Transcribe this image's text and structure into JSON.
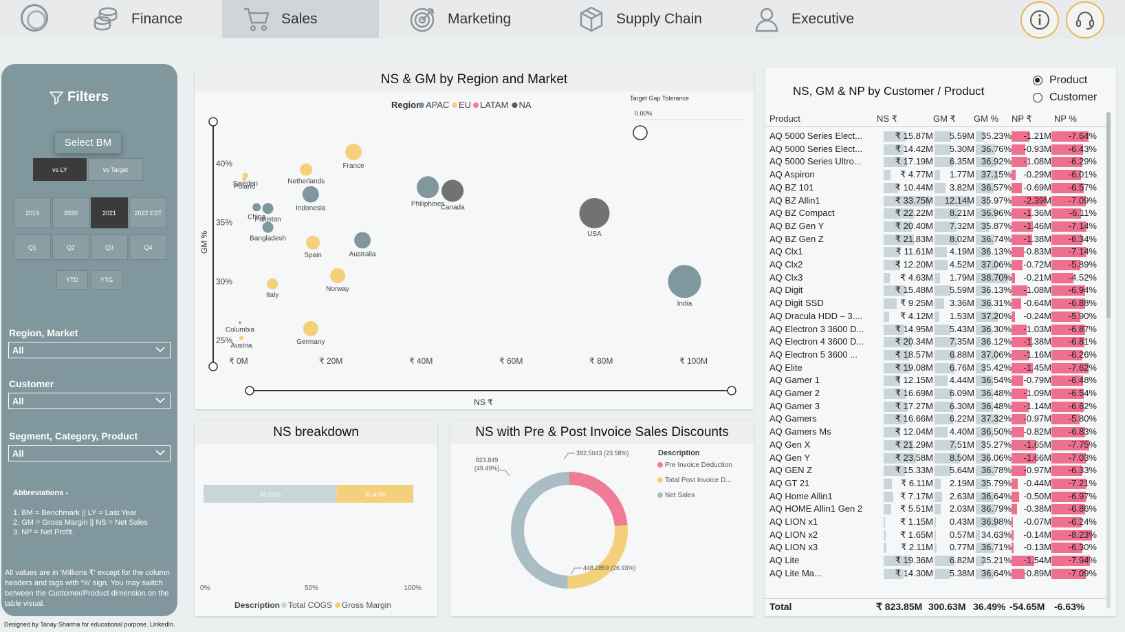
{
  "nav": {
    "tabs": [
      {
        "label": "Finance",
        "icon": "coins-icon"
      },
      {
        "label": "Sales",
        "icon": "cart-icon"
      },
      {
        "label": "Marketing",
        "icon": "target-icon"
      },
      {
        "label": "Supply Chain",
        "icon": "box-icon"
      },
      {
        "label": "Executive",
        "icon": "person-icon"
      }
    ],
    "active_tab": "Sales",
    "accent": "#e4b85a"
  },
  "filters": {
    "title": "Filters",
    "select_bm": "Select BM",
    "bm_options": [
      "vs LY",
      "vs Target"
    ],
    "bm_selected": "vs LY",
    "years": [
      "2019",
      "2020",
      "2021",
      "2022 EST"
    ],
    "year_selected": "2021",
    "quarters": [
      "Q1",
      "Q2",
      "Q3",
      "Q4"
    ],
    "periods": [
      "YTD",
      "YTG"
    ],
    "region_label": "Region, Market",
    "region_value": "All",
    "customer_label": "Customer",
    "customer_value": "All",
    "segment_label": "Segment, Category, Product",
    "segment_value": "All",
    "abbr_title": "Abbreviations -",
    "abbr_lines": [
      "1. BM = Benchmark || LY = Last Year",
      "2. GM = Gross Margin || NS = Net Sales",
      "3. NP = Net Profit."
    ],
    "note": "All values are in 'Millions ₹' except for the column headers and tags with '%' sign. You may switch between the Customer/Product dimension on the table visual.",
    "credit": "Designed by Tanay Sharma for educational purpose. LinkedIn."
  },
  "scatter": {
    "title": "NS & GM by Region and Market",
    "legend_title": "Region",
    "target_gap_label": "Target Gap Tolerance",
    "target_gap_value": "0.00%",
    "ylabel": "GM %",
    "xlabel": "NS ₹",
    "y_ticks": [
      "40%",
      "35%",
      "30%",
      "25%"
    ],
    "x_ticks": [
      "₹ 0M",
      "₹ 20M",
      "₹ 40M",
      "₹ 60M",
      "₹ 80M",
      "₹ 100M"
    ]
  },
  "ns_breakdown": {
    "title": "NS breakdown",
    "x_ticks": [
      "0%",
      "50%",
      "100%"
    ],
    "legend_title": "Description"
  },
  "donut": {
    "title": "NS with Pre & Post Invoice Sales Discounts",
    "legend_title": "Description"
  },
  "table": {
    "title": "NS, GM & NP by Customer / Product",
    "radio_options": [
      "Product",
      "Customer"
    ],
    "radio_selected": "Product",
    "headers": [
      "Product",
      "NS ₹",
      "GM ₹",
      "GM %",
      "NP ₹",
      "NP %"
    ],
    "rows": [
      [
        "AQ 5000 Series Elect...",
        "₹ 15.87M",
        "5.59M",
        "35.23%",
        "-1.21M",
        "-7.64%"
      ],
      [
        "AQ 5000 Series Elect...",
        "₹ 14.42M",
        "5.30M",
        "36.76%",
        "-0.93M",
        "-6.43%"
      ],
      [
        "AQ 5000 Series Ultro...",
        "₹ 17.19M",
        "6.35M",
        "36.92%",
        "-1.08M",
        "-6.29%"
      ],
      [
        "AQ Aspiron",
        "₹ 4.77M",
        "1.77M",
        "37.15%",
        "-0.29M",
        "-6.01%"
      ],
      [
        "AQ BZ 101",
        "₹ 10.44M",
        "3.82M",
        "36.57%",
        "-0.69M",
        "-6.57%"
      ],
      [
        "AQ BZ Allin1",
        "₹ 33.75M",
        "12.14M",
        "35.97%",
        "-2.39M",
        "-7.09%"
      ],
      [
        "AQ BZ Compact",
        "₹ 22.22M",
        "8.21M",
        "36.96%",
        "-1.36M",
        "-6.11%"
      ],
      [
        "AQ BZ Gen Y",
        "₹ 20.40M",
        "7.32M",
        "35.87%",
        "-1.46M",
        "-7.14%"
      ],
      [
        "AQ BZ Gen Z",
        "₹ 21.83M",
        "8.02M",
        "36.74%",
        "-1.38M",
        "-6.34%"
      ],
      [
        "AQ Clx1",
        "₹ 11.61M",
        "4.19M",
        "36.13%",
        "-0.83M",
        "-7.14%"
      ],
      [
        "AQ Clx2",
        "₹ 12.20M",
        "4.52M",
        "37.06%",
        "-0.72M",
        "-5.89%"
      ],
      [
        "AQ Clx3",
        "₹ 4.63M",
        "1.79M",
        "38.70%",
        "-0.21M",
        "-4.52%"
      ],
      [
        "AQ Digit",
        "₹ 15.48M",
        "5.59M",
        "36.13%",
        "-1.08M",
        "-6.94%"
      ],
      [
        "AQ Digit SSD",
        "₹ 9.25M",
        "3.36M",
        "36.31%",
        "-0.64M",
        "-6.88%"
      ],
      [
        "AQ Dracula HDD – 3....",
        "₹ 4.12M",
        "1.53M",
        "37.20%",
        "-0.24M",
        "-5.90%"
      ],
      [
        "AQ Electron 3 3600 D...",
        "₹ 14.95M",
        "5.43M",
        "36.30%",
        "-1.03M",
        "-6.87%"
      ],
      [
        "AQ Electron 4 3600 D...",
        "₹ 20.34M",
        "7.35M",
        "36.12%",
        "-1.38M",
        "-6.81%"
      ],
      [
        "AQ Electron 5 3600 ...",
        "₹ 18.57M",
        "6.88M",
        "37.06%",
        "-1.16M",
        "-6.26%"
      ],
      [
        "AQ Elite",
        "₹ 19.08M",
        "6.76M",
        "35.42%",
        "-1.45M",
        "-7.62%"
      ],
      [
        "AQ Gamer 1",
        "₹ 12.15M",
        "4.44M",
        "36.54%",
        "-0.79M",
        "-6.48%"
      ],
      [
        "AQ Gamer 2",
        "₹ 16.69M",
        "6.09M",
        "36.48%",
        "-1.09M",
        "-6.54%"
      ],
      [
        "AQ Gamer 3",
        "₹ 17.27M",
        "6.30M",
        "36.48%",
        "-1.14M",
        "-6.62%"
      ],
      [
        "AQ Gamers",
        "₹ 16.66M",
        "6.22M",
        "37.32%",
        "-0.97M",
        "-5.80%"
      ],
      [
        "AQ Gamers Ms",
        "₹ 12.04M",
        "4.40M",
        "36.50%",
        "-0.82M",
        "-6.83%"
      ],
      [
        "AQ Gen X",
        "₹ 21.29M",
        "7.51M",
        "35.27%",
        "-1.65M",
        "-7.75%"
      ],
      [
        "AQ Gen Y",
        "₹ 23.58M",
        "8.50M",
        "36.06%",
        "-1.66M",
        "-7.03%"
      ],
      [
        "AQ GEN Z",
        "₹ 15.33M",
        "5.64M",
        "36.78%",
        "-0.97M",
        "-6.33%"
      ],
      [
        "AQ GT 21",
        "₹ 6.11M",
        "2.19M",
        "35.79%",
        "-0.44M",
        "-7.21%"
      ],
      [
        "AQ Home Allin1",
        "₹ 7.17M",
        "2.63M",
        "36.64%",
        "-0.50M",
        "-6.97%"
      ],
      [
        "AQ HOME Allin1 Gen 2",
        "₹ 5.51M",
        "2.03M",
        "36.79%",
        "-0.38M",
        "-6.86%"
      ],
      [
        "AQ LION x1",
        "₹ 1.15M",
        "0.43M",
        "36.98%",
        "-0.07M",
        "-6.24%"
      ],
      [
        "AQ LION x2",
        "₹ 1.65M",
        "0.57M",
        "34.63%",
        "-0.14M",
        "-8.23%"
      ],
      [
        "AQ LION x3",
        "₹ 2.11M",
        "0.77M",
        "36.71%",
        "-0.13M",
        "-6.30%"
      ],
      [
        "AQ Lite",
        "₹ 19.36M",
        "6.82M",
        "35.21%",
        "-1.54M",
        "-7.94%"
      ]
    ],
    "partial_row": [
      "AQ Lite Ma...",
      "₹ 14.30M",
      "5.38M",
      "36.64%",
      "-0.89M",
      "-7.09%"
    ],
    "total": [
      "Total",
      "₹ 823.85M",
      "300.63M",
      "36.49%",
      "-54.65M",
      "-6.63%"
    ]
  },
  "chart_data": [
    {
      "type": "scatter",
      "title": "NS & GM by Region and Market",
      "xlabel": "NS ₹",
      "ylabel": "GM %",
      "xlim": [
        0,
        100
      ],
      "ylim": [
        24,
        42.5
      ],
      "legend_title": "Region",
      "legend_position": "top",
      "series": [
        {
          "name": "APAC",
          "color": "#7f979d",
          "points": [
            {
              "label": "Indonesia",
              "x": 16,
              "y": 37.4,
              "size": 12
            },
            {
              "label": "Philiphines",
              "x": 42,
              "y": 38.0,
              "size": 16
            },
            {
              "label": "China",
              "x": 4,
              "y": 36.3,
              "size": 6
            },
            {
              "label": "Pakistan",
              "x": 6.5,
              "y": 36.2,
              "size": 8
            },
            {
              "label": "Bangladesh",
              "x": 6.5,
              "y": 34.6,
              "size": 8
            },
            {
              "label": "Australia",
              "x": 27.5,
              "y": 33.5,
              "size": 12
            },
            {
              "label": "India",
              "x": 99,
              "y": 30.0,
              "size": 24
            }
          ]
        },
        {
          "name": "EU",
          "color": "#f5d07a",
          "points": [
            {
              "label": "France",
              "x": 25.5,
              "y": 41.0,
              "size": 12
            },
            {
              "label": "Netherlands",
              "x": 15,
              "y": 39.5,
              "size": 9
            },
            {
              "label": "Sweden",
              "x": 1.5,
              "y": 39.0,
              "size": 4
            },
            {
              "label": "Poland",
              "x": 1.3,
              "y": 38.7,
              "size": 3
            },
            {
              "label": "Spain",
              "x": 16.5,
              "y": 33.3,
              "size": 10
            },
            {
              "label": "Norway",
              "x": 22,
              "y": 30.5,
              "size": 11
            },
            {
              "label": "Italy",
              "x": 7.5,
              "y": 29.8,
              "size": 8
            },
            {
              "label": "Germany",
              "x": 16,
              "y": 26.0,
              "size": 11
            },
            {
              "label": "Austria",
              "x": 0.6,
              "y": 25.2,
              "size": 3
            }
          ]
        },
        {
          "name": "LATAM",
          "color": "#ef7b97",
          "points": [
            {
              "label": "Columbia",
              "x": 0.3,
              "y": 26.5,
              "size": 2
            }
          ]
        },
        {
          "name": "NA",
          "color": "#5a5a5a",
          "points": [
            {
              "label": "Canada",
              "x": 47.5,
              "y": 37.7,
              "size": 16
            },
            {
              "label": "USA",
              "x": 79,
              "y": 35.8,
              "size": 22
            }
          ]
        }
      ]
    },
    {
      "type": "bar",
      "title": "NS breakdown",
      "orientation": "horizontal-stacked",
      "legend_title": "Description",
      "series": [
        {
          "name": "Total COGS",
          "values": [
            63.51
          ],
          "label": "63.51%",
          "color": "#c9d5d9"
        },
        {
          "name": "Gross Margin",
          "values": [
            36.49
          ],
          "label": "36.49%",
          "color": "#f5d07a"
        }
      ],
      "xlim": [
        0,
        100
      ]
    },
    {
      "type": "pie",
      "title": "NS with Pre & Post Invoice Sales Discounts",
      "legend_title": "Description",
      "slices": [
        {
          "name": "Pre Invoice Deduction",
          "value": 392.5043,
          "percent": 23.58,
          "label": "392.5043 (23.58%)",
          "color": "#ef7b97"
        },
        {
          "name": "Total Post Invoice D...",
          "value": 448.2859,
          "percent": 26.93,
          "label": "448.2859 (26.93%)",
          "color": "#f5d07a"
        },
        {
          "name": "Net Sales",
          "value": 823.849,
          "percent": 49.49,
          "label": "823.849 (49.49%)",
          "color": "#a9bec4"
        }
      ]
    }
  ]
}
